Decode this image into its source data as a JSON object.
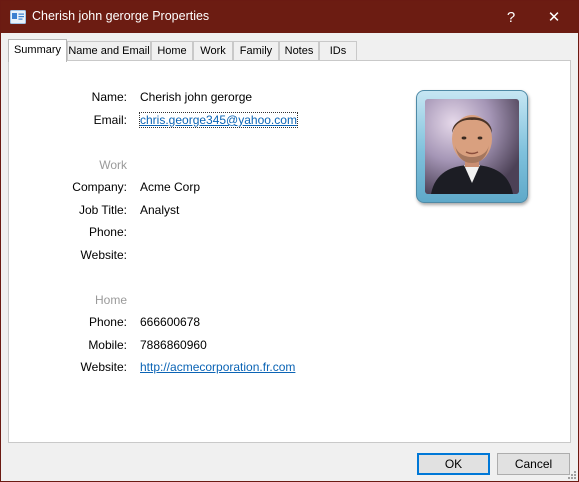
{
  "window": {
    "title": "Cherish john gerorge Properties",
    "help_label": "?",
    "close_label": "✕"
  },
  "tabs": [
    {
      "label": "Summary",
      "active": true
    },
    {
      "label": "Name and Email"
    },
    {
      "label": "Home"
    },
    {
      "label": "Work"
    },
    {
      "label": "Family"
    },
    {
      "label": "Notes"
    },
    {
      "label": "IDs"
    }
  ],
  "summary": {
    "name_label": "Name:",
    "name_value": "Cherish john gerorge",
    "email_label": "Email:",
    "email_value": "chris.george345@yahoo.com",
    "work_heading": "Work",
    "company_label": "Company:",
    "company_value": "Acme Corp",
    "job_title_label": "Job Title:",
    "job_title_value": "Analyst",
    "work_phone_label": "Phone:",
    "work_phone_value": "",
    "work_website_label": "Website:",
    "work_website_value": "",
    "home_heading": "Home",
    "home_phone_label": "Phone:",
    "home_phone_value": "666600678",
    "mobile_label": "Mobile:",
    "mobile_value": "7886860960",
    "home_website_label": "Website:",
    "home_website_value": "http://acmecorporation.fr.com"
  },
  "buttons": {
    "ok_label": "OK",
    "cancel_label": "Cancel"
  },
  "colors": {
    "titlebar": "#6c1c12",
    "link": "#0b64b5",
    "accent": "#0078d7"
  }
}
